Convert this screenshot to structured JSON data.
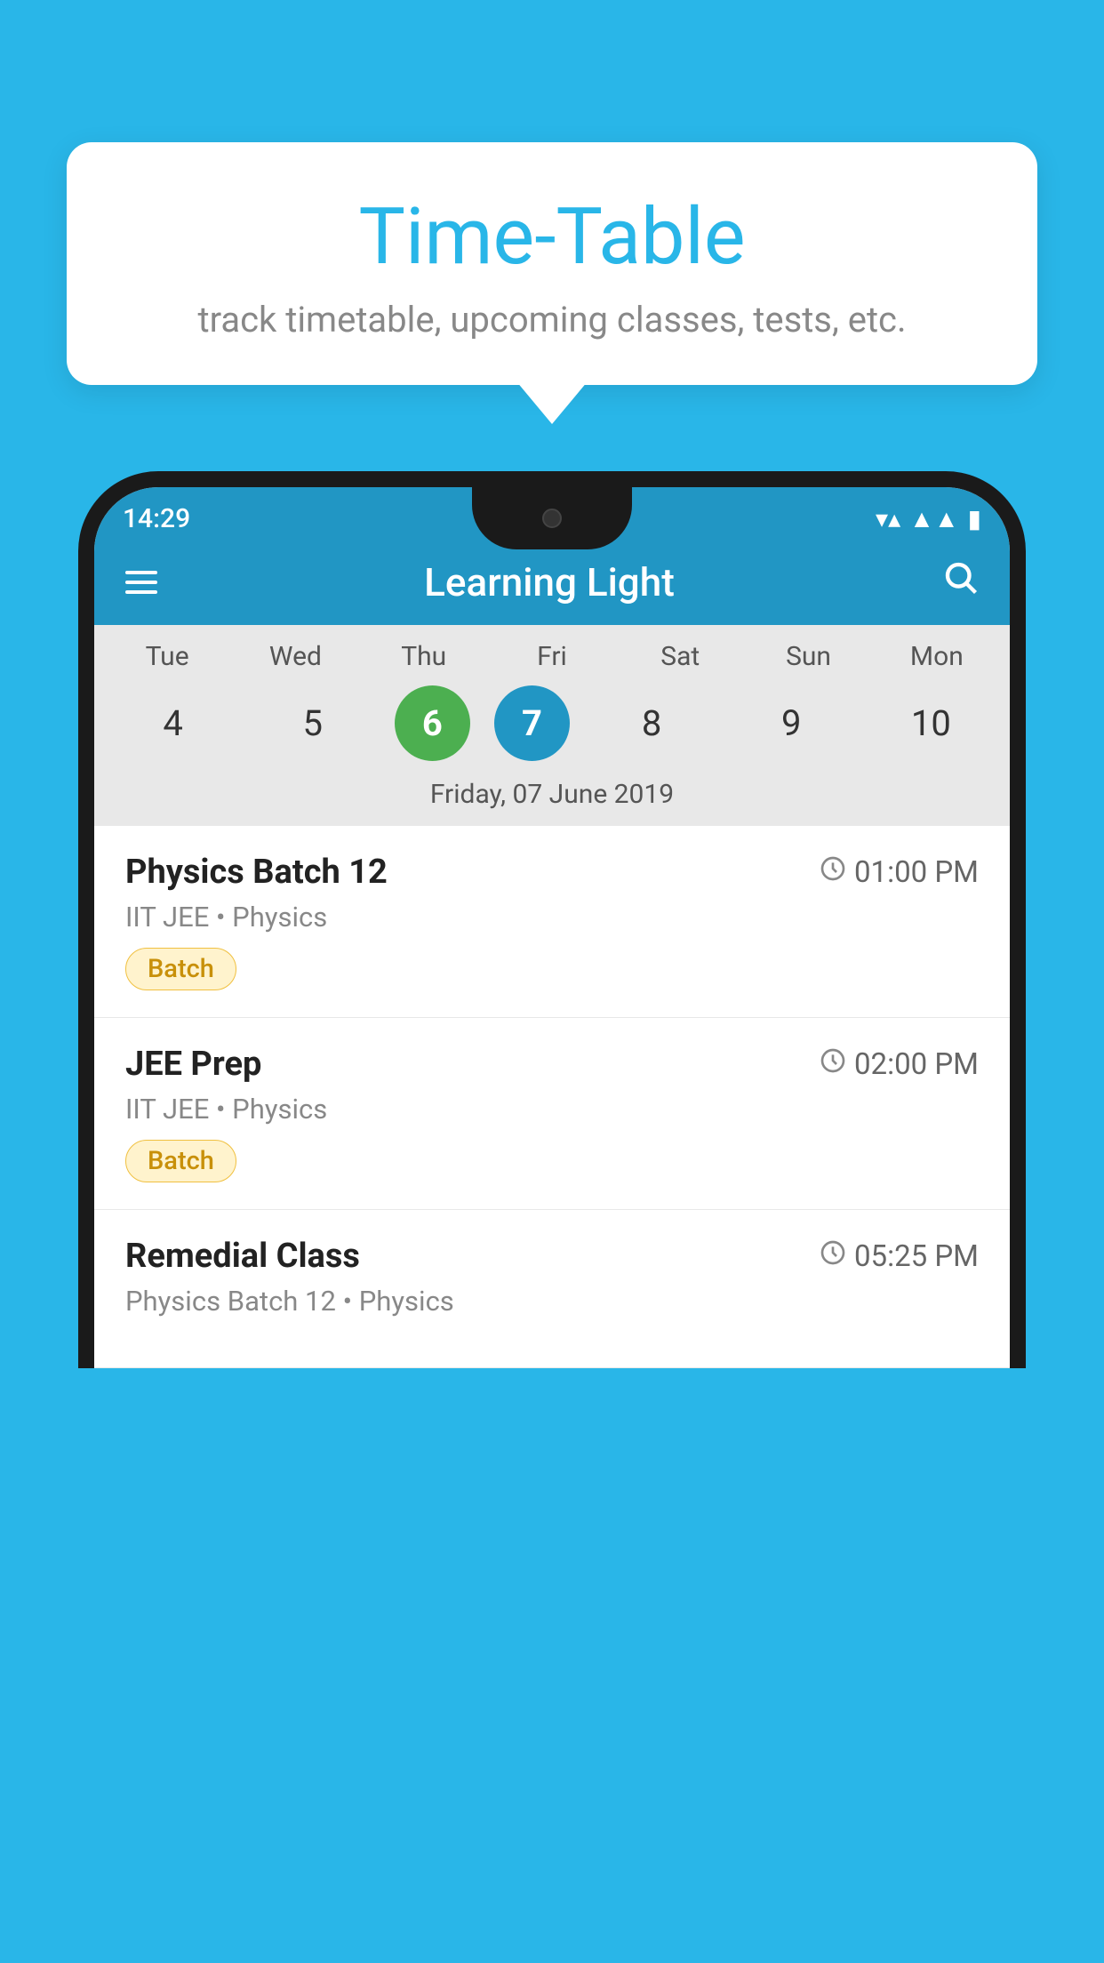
{
  "background_color": "#29b6e8",
  "bubble": {
    "title": "Time-Table",
    "subtitle": "track timetable, upcoming classes, tests, etc."
  },
  "phone": {
    "status_bar": {
      "time": "14:29",
      "wifi": "▼▲",
      "battery": "█"
    },
    "app_bar": {
      "title": "Learning Light",
      "menu_icon": "hamburger",
      "search_icon": "search"
    },
    "calendar": {
      "days": [
        "Tue",
        "Wed",
        "Thu",
        "Fri",
        "Sat",
        "Sun",
        "Mon"
      ],
      "dates": [
        4,
        5,
        6,
        7,
        8,
        9,
        10
      ],
      "today_index": 2,
      "selected_index": 3,
      "selected_date_label": "Friday, 07 June 2019"
    },
    "classes": [
      {
        "name": "Physics Batch 12",
        "time": "01:00 PM",
        "meta": "IIT JEE • Physics",
        "badge": "Batch"
      },
      {
        "name": "JEE Prep",
        "time": "02:00 PM",
        "meta": "IIT JEE • Physics",
        "badge": "Batch"
      },
      {
        "name": "Remedial Class",
        "time": "05:25 PM",
        "meta": "Physics Batch 12 • Physics",
        "badge": ""
      }
    ]
  }
}
